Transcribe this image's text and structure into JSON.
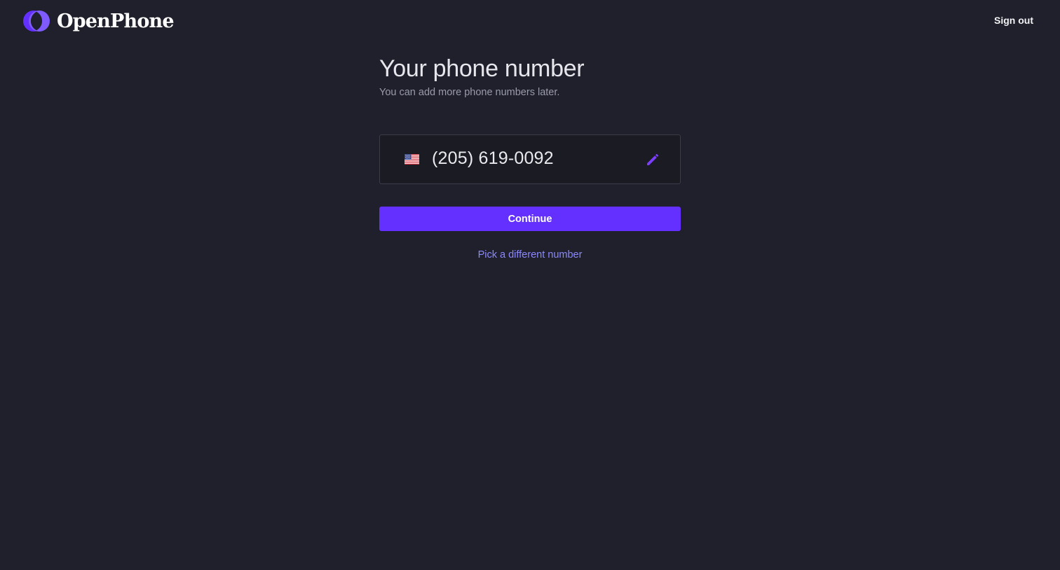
{
  "header": {
    "brand": "OpenPhone",
    "sign_out_label": "Sign out"
  },
  "main": {
    "title": "Your phone number",
    "subtitle": "You can add more phone numbers later.",
    "phone_number": "(205) 619-0092",
    "country_flag_icon": "us-flag-icon",
    "edit_icon": "pencil-icon",
    "continue_label": "Continue",
    "alternate_link_label": "Pick a different number"
  },
  "colors": {
    "background": "#1f202b",
    "accent": "#6330ff",
    "link": "#8c88ff",
    "input_background": "#1b1b24"
  }
}
